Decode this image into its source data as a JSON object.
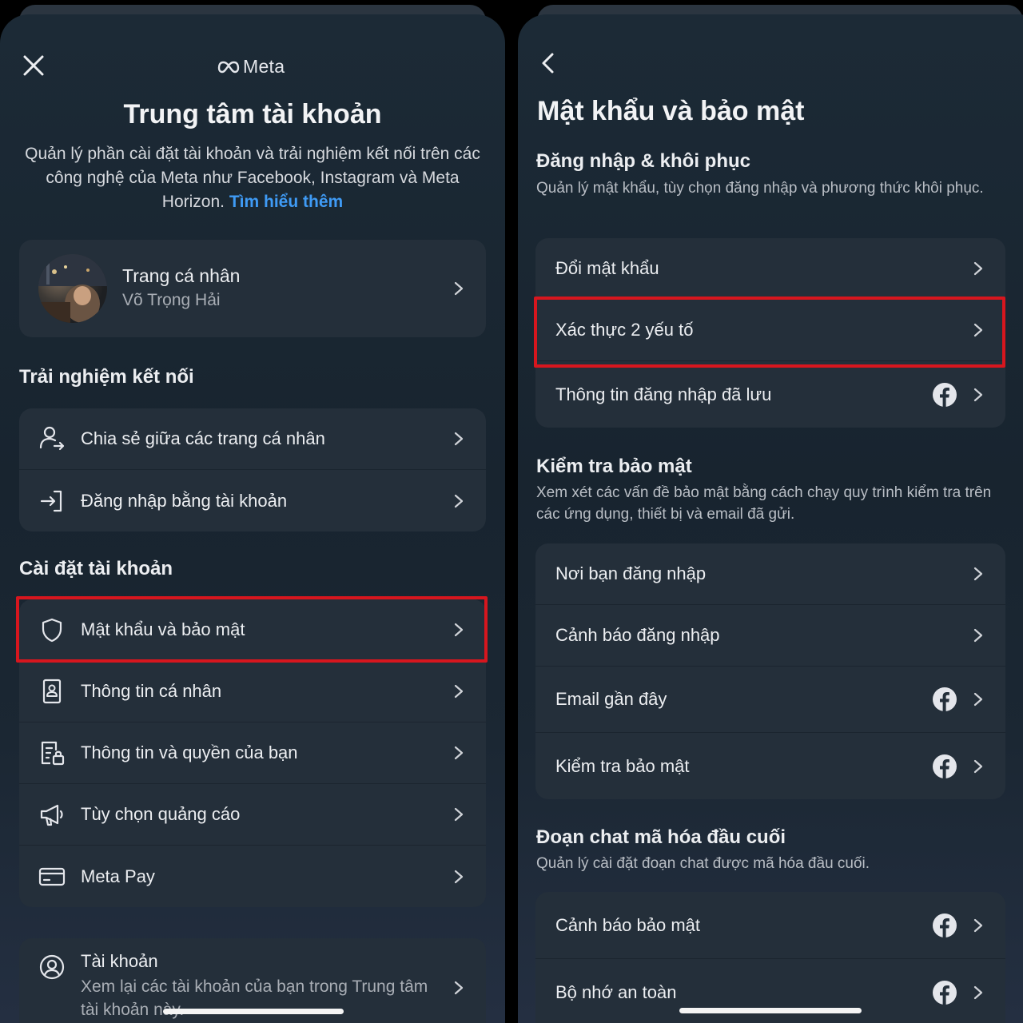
{
  "left": {
    "brand": "Meta",
    "title": "Trung tâm tài khoản",
    "intro": "Quản lý phần cài đặt tài khoản và trải nghiệm kết nối trên các công nghệ của Meta như Facebook, Instagram và Meta Horizon.",
    "intro_link": "Tìm hiểu thêm",
    "profile": {
      "title": "Trang cá nhân",
      "name": "Võ Trọng Hải"
    },
    "connected_heading": "Trải nghiệm kết nối",
    "connected": [
      {
        "label": "Chia sẻ giữa các trang cá nhân",
        "icon": "share-profiles-icon"
      },
      {
        "label": "Đăng nhập bằng tài khoản",
        "icon": "login-icon"
      }
    ],
    "settings_heading": "Cài đặt tài khoản",
    "settings": [
      {
        "label": "Mật khẩu và bảo mật",
        "icon": "shield-icon",
        "highlighted": true
      },
      {
        "label": "Thông tin cá nhân",
        "icon": "id-card-icon"
      },
      {
        "label": "Thông tin và quyền của bạn",
        "icon": "document-lock-icon"
      },
      {
        "label": "Tùy chọn quảng cáo",
        "icon": "megaphone-icon"
      },
      {
        "label": "Meta Pay",
        "icon": "credit-card-icon"
      }
    ],
    "account": {
      "title": "Tài khoản",
      "sub": "Xem lại các tài khoản của bạn trong Trung tâm tài khoản này."
    }
  },
  "right": {
    "title": "Mật khẩu và bảo mật",
    "login_heading": "Đăng nhập & khôi phục",
    "login_sub": "Quản lý mật khẩu, tùy chọn đăng nhập và phương thức khôi phục.",
    "login_items": [
      {
        "label": "Đổi mật khẩu",
        "fb": false
      },
      {
        "label": "Xác thực 2 yếu tố",
        "fb": false,
        "highlighted": true
      },
      {
        "label": "Thông tin đăng nhập đã lưu",
        "fb": true
      }
    ],
    "check_heading": "Kiểm tra bảo mật",
    "check_sub": "Xem xét các vấn đề bảo mật bằng cách chạy quy trình kiểm tra trên các ứng dụng, thiết bị và email đã gửi.",
    "check_items": [
      {
        "label": "Nơi bạn đăng nhập",
        "fb": false
      },
      {
        "label": "Cảnh báo đăng nhập",
        "fb": false
      },
      {
        "label": "Email gần đây",
        "fb": true
      },
      {
        "label": "Kiểm tra bảo mật",
        "fb": true
      }
    ],
    "e2e_heading": "Đoạn chat mã hóa đầu cuối",
    "e2e_sub": "Quản lý cài đặt đoạn chat được mã hóa đầu cuối.",
    "e2e_items": [
      {
        "label": "Cảnh báo bảo mật",
        "fb": true
      },
      {
        "label": "Bộ nhớ an toàn",
        "fb": true
      }
    ]
  },
  "colors": {
    "accent_link": "#3f9bf5",
    "highlight": "#d7161e",
    "card": "#242f3a"
  }
}
